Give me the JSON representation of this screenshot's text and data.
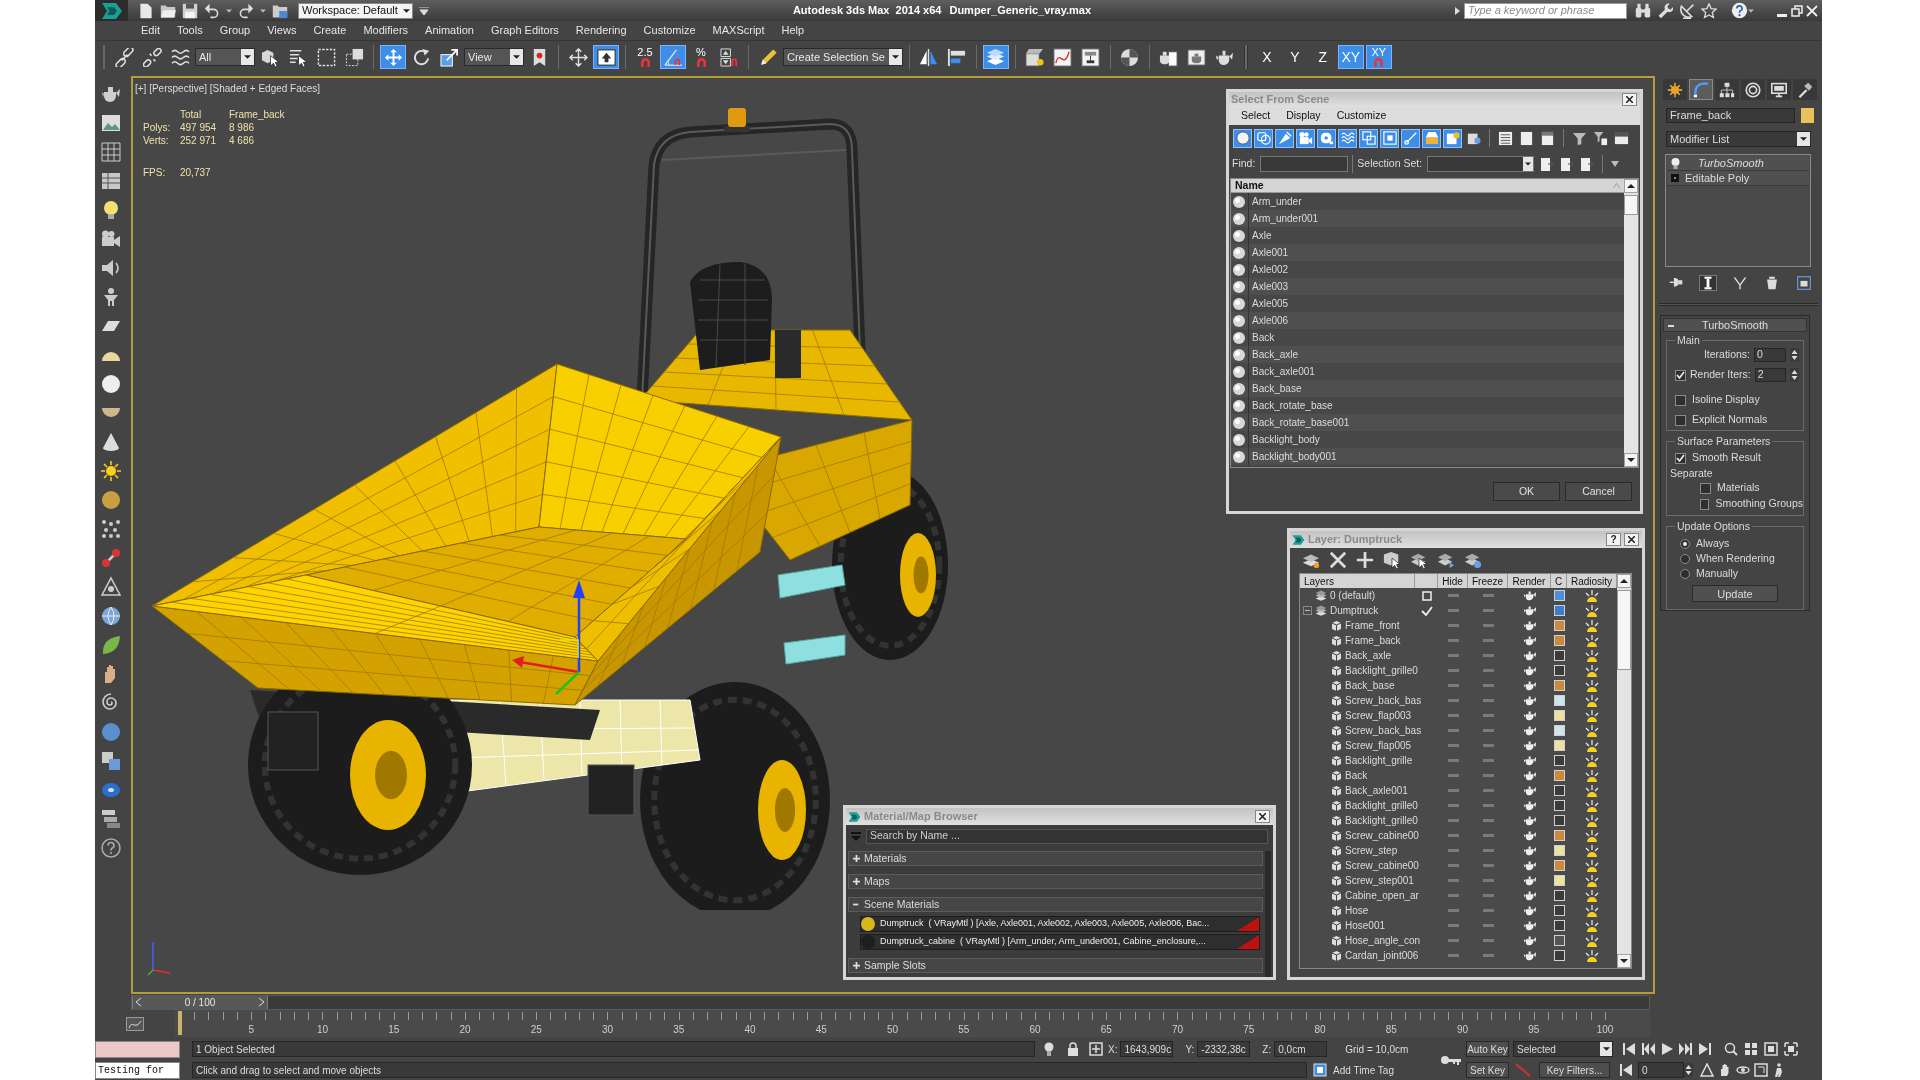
{
  "window": {
    "title": "Autodesk 3ds Max  2014 x64",
    "file": "Dumper_Generic_vray.max",
    "workspace": "Workspace: Default",
    "search": {
      "placeholder": "Type a keyword or phrase"
    }
  },
  "menu": [
    "Edit",
    "Tools",
    "Group",
    "Views",
    "Create",
    "Modifiers",
    "Animation",
    "Graph Editors",
    "Rendering",
    "Customize",
    "MAXScript",
    "Help"
  ],
  "main_toolbar": [
    [
      {
        "kind": "link",
        "selected": false
      },
      {
        "kind": "unlink",
        "selected": false
      },
      {
        "kind": "bind_warp",
        "selected": false
      },
      {
        "kind": "dropdown",
        "value": "All"
      },
      {
        "kind": "select",
        "selected": false
      },
      {
        "kind": "select_by_name",
        "selected": false
      },
      {
        "kind": "rect_region",
        "selected": false
      },
      {
        "kind": "window_crossing",
        "selected": false
      }
    ],
    [
      {
        "kind": "move",
        "selected": true
      },
      {
        "kind": "rotate",
        "selected": false
      },
      {
        "kind": "scale",
        "selected": false
      },
      {
        "kind": "dropdown",
        "value": "View"
      },
      {
        "kind": "pivot",
        "selected": false
      }
    ],
    [
      {
        "kind": "manipulate",
        "selected": false
      },
      {
        "kind": "keyboard_override",
        "selected": true
      }
    ],
    [
      {
        "kind": "snap",
        "label": "2.5",
        "selected": false
      },
      {
        "kind": "angle_snap",
        "selected": true
      },
      {
        "kind": "snap",
        "label": "%",
        "selected": false
      },
      {
        "kind": "spinner_snap",
        "selected": false
      }
    ],
    [
      {
        "kind": "edit_named_sel",
        "selected": false
      },
      {
        "kind": "dropdown",
        "value": "Create Selection Se"
      }
    ],
    [
      {
        "kind": "mirror",
        "selected": false
      },
      {
        "kind": "align",
        "selected": false
      }
    ],
    [
      {
        "kind": "layer_manager",
        "selected": true
      }
    ],
    [
      {
        "kind": "scene_explorer",
        "selected": false
      },
      {
        "kind": "curve_editor",
        "selected": false
      },
      {
        "kind": "schematic",
        "selected": false
      }
    ],
    [
      {
        "kind": "material_editor",
        "selected": false
      }
    ],
    [
      {
        "kind": "render_setup",
        "selected": false
      },
      {
        "kind": "rendered_frame",
        "selected": false
      },
      {
        "kind": "render",
        "selected": false
      }
    ],
    [
      {
        "kind": "axis",
        "label": "X",
        "selected": false
      },
      {
        "kind": "axis",
        "label": "Y",
        "selected": false
      },
      {
        "kind": "axis",
        "label": "Z",
        "selected": false
      },
      {
        "kind": "axis",
        "label": "XY",
        "selected": true
      },
      {
        "kind": "axis_snap",
        "label": "XY",
        "selected": true
      }
    ]
  ],
  "viewport": {
    "label": "[+] [Perspective] [Shaded + Edged Faces]",
    "active": true,
    "stats": {
      "header": [
        "Total",
        "Frame_back"
      ],
      "rows": [
        {
          "label": "Polys:",
          "values": [
            "497 954",
            "8 986"
          ]
        },
        {
          "label": "Verts:",
          "values": [
            "252 971",
            "4 686"
          ]
        }
      ],
      "fps_label": "FPS:",
      "fps": "20,737"
    }
  },
  "select_from_scene": {
    "title": "Select From Scene",
    "menu": [
      "Select",
      "Display",
      "Customize"
    ],
    "filters": [
      {
        "kind": "geometry",
        "on": true
      },
      {
        "kind": "shapes",
        "on": true
      },
      {
        "kind": "lights",
        "on": true
      },
      {
        "kind": "cameras",
        "on": true
      },
      {
        "kind": "helpers",
        "on": true
      },
      {
        "kind": "space_warps",
        "on": true
      },
      {
        "kind": "groups",
        "on": true
      },
      {
        "kind": "xrefs",
        "on": true
      },
      {
        "kind": "bones",
        "on": true
      },
      {
        "kind": "containers",
        "on": true
      },
      {
        "kind": "frozen",
        "on": true
      },
      {
        "kind": "hidden",
        "on": false
      }
    ],
    "find_label": "Find:",
    "selection_set_label": "Selection Set:",
    "column": "Name",
    "rows": [
      {
        "name": "Arm_under",
        "selected": false
      },
      {
        "name": "Arm_under001",
        "selected": false
      },
      {
        "name": "Axle",
        "selected": false
      },
      {
        "name": "Axle001",
        "selected": false
      },
      {
        "name": "Axle002",
        "selected": false
      },
      {
        "name": "Axle003",
        "selected": false
      },
      {
        "name": "Axle005",
        "selected": false
      },
      {
        "name": "Axle006",
        "selected": false
      },
      {
        "name": "Back",
        "selected": false
      },
      {
        "name": "Back_axle",
        "selected": false
      },
      {
        "name": "Back_axle001",
        "selected": false
      },
      {
        "name": "Back_base",
        "selected": false
      },
      {
        "name": "Back_rotate_base",
        "selected": false
      },
      {
        "name": "Back_rotate_base001",
        "selected": false
      },
      {
        "name": "Backlight_body",
        "selected": false
      },
      {
        "name": "Backlight_body001",
        "selected": false
      }
    ],
    "buttons": [
      "OK",
      "Cancel"
    ]
  },
  "layer_manager": {
    "title": "Layer: Dumptruck",
    "help": "?",
    "columns": [
      "Layers",
      "Hide",
      "Freeze",
      "Render",
      "C",
      "Radiosity"
    ],
    "layers": [
      {
        "name": "0 (default)",
        "current": false,
        "hidden": false,
        "frozen": false,
        "renderable": true,
        "color": "#4a8fd8",
        "selected": false
      },
      {
        "name": "Dumptruck",
        "current": true,
        "expanded": true,
        "hidden": false,
        "frozen": false,
        "renderable": true,
        "color": "#3b7fc6",
        "selected": false,
        "children": [
          {
            "name": "Frame_front",
            "hidden": false,
            "frozen": false,
            "renderable": true,
            "color": "#c98a3e",
            "selected": false
          },
          {
            "name": "Frame_back",
            "hidden": false,
            "frozen": false,
            "renderable": true,
            "color": "#c98a3e",
            "selected": false
          },
          {
            "name": "Back_axle",
            "hidden": false,
            "frozen": false,
            "renderable": true,
            "color": "#3a3a3a",
            "selected": false
          },
          {
            "name": "Backlight_grille0",
            "hidden": false,
            "frozen": false,
            "renderable": true,
            "color": "#3a3a3a",
            "selected": false
          },
          {
            "name": "Back_base",
            "hidden": false,
            "frozen": false,
            "renderable": true,
            "color": "#c98a3e",
            "selected": false
          },
          {
            "name": "Screw_back_bas",
            "hidden": false,
            "frozen": false,
            "renderable": true,
            "color": "#cde6ee",
            "selected": false
          },
          {
            "name": "Screw_flap003",
            "hidden": false,
            "frozen": false,
            "renderable": true,
            "color": "#ece3a0",
            "selected": false
          },
          {
            "name": "Screw_back_bas",
            "hidden": false,
            "frozen": false,
            "renderable": true,
            "color": "#cde6ee",
            "selected": false
          },
          {
            "name": "Screw_flap005",
            "hidden": false,
            "frozen": false,
            "renderable": true,
            "color": "#ece3a0",
            "selected": false
          },
          {
            "name": "Backlight_grille",
            "hidden": false,
            "frozen": false,
            "renderable": true,
            "color": "#3a3a3a",
            "selected": false
          },
          {
            "name": "Back",
            "hidden": false,
            "frozen": false,
            "renderable": true,
            "color": "#c98a3e",
            "selected": false
          },
          {
            "name": "Back_axle001",
            "hidden": false,
            "frozen": false,
            "renderable": true,
            "color": "#3a3a3a",
            "selected": false
          },
          {
            "name": "Backlight_grille0",
            "hidden": false,
            "frozen": false,
            "renderable": true,
            "color": "#3a3a3a",
            "selected": false
          },
          {
            "name": "Backlight_grille0",
            "hidden": false,
            "frozen": false,
            "renderable": true,
            "color": "#3a3a3a",
            "selected": false
          },
          {
            "name": "Screw_cabine00",
            "hidden": false,
            "frozen": false,
            "renderable": true,
            "color": "#c98a3e",
            "selected": false
          },
          {
            "name": "Screw_step",
            "hidden": false,
            "frozen": false,
            "renderable": true,
            "color": "#ece3a0",
            "selected": false
          },
          {
            "name": "Screw_cabine00",
            "hidden": false,
            "frozen": false,
            "renderable": true,
            "color": "#c98a3e",
            "selected": false
          },
          {
            "name": "Screw_step001",
            "hidden": false,
            "frozen": false,
            "renderable": true,
            "color": "#ece3a0",
            "selected": false
          },
          {
            "name": "Cabine_open_ar",
            "hidden": false,
            "frozen": false,
            "renderable": true,
            "color": "#3a3a3a",
            "selected": false
          },
          {
            "name": "Hose",
            "hidden": false,
            "frozen": false,
            "renderable": true,
            "color": "#3a3a3a",
            "selected": false
          },
          {
            "name": "Hose001",
            "hidden": false,
            "frozen": false,
            "renderable": true,
            "color": "#3a3a3a",
            "selected": false
          },
          {
            "name": "Hose_angle_con",
            "hidden": false,
            "frozen": false,
            "renderable": true,
            "color": "#555555",
            "selected": false
          },
          {
            "name": "Cardan_joint006",
            "hidden": false,
            "frozen": false,
            "renderable": true,
            "color": "#3a3a3a",
            "selected": false
          }
        ]
      }
    ]
  },
  "material_browser": {
    "title": "Material/Map Browser",
    "search": {
      "placeholder": "Search by Name ..."
    },
    "groups": [
      {
        "label": "Materials",
        "expanded": false
      },
      {
        "label": "Maps",
        "expanded": false
      },
      {
        "label": "Scene Materials",
        "expanded": true,
        "items": [
          {
            "text": "Dumptruck  ( VRayMtl ) [Axle, Axle001, Axle002, Axle003, Axle005, Axle006, Bac...",
            "color": "#d8b818",
            "selected": false
          },
          {
            "text": "Dumptruck_cabine  ( VRayMtl ) [Arm_under, Arm_under001, Cabine_enclosure,...",
            "color": "#1e1e1e",
            "selected": false
          }
        ]
      },
      {
        "label": "Sample Slots",
        "expanded": false
      }
    ]
  },
  "command_panel": {
    "tabs": [
      {
        "kind": "create",
        "selected": false
      },
      {
        "kind": "modify",
        "selected": true
      },
      {
        "kind": "hierarchy",
        "selected": false
      },
      {
        "kind": "motion",
        "selected": false
      },
      {
        "kind": "display",
        "selected": false
      },
      {
        "kind": "utilities",
        "selected": false
      }
    ],
    "object": {
      "name": "Frame_back",
      "color": "#e8c35a"
    },
    "modifier_list": "Modifier List",
    "stack": [
      {
        "name": "TurboSmooth",
        "kind": "modifier",
        "viewport_off": true,
        "selected": false
      },
      {
        "name": "Editable Poly",
        "kind": "base_object",
        "viewport_off": false,
        "selected": false
      }
    ],
    "stack_tools": [
      {
        "kind": "pin",
        "on": false
      },
      {
        "kind": "show_end_result",
        "on": true
      },
      {
        "kind": "make_unique",
        "on": false
      },
      {
        "kind": "remove",
        "on": false
      },
      {
        "kind": "configure",
        "on": false
      }
    ],
    "rollout": {
      "title": "TurboSmooth",
      "expanded": true,
      "main": {
        "label": "Main",
        "iterations": {
          "label": "Iterations:",
          "value": "0"
        },
        "render_iters": {
          "label": "Render Iters:",
          "value": "2",
          "checked": true
        },
        "options": [
          {
            "label": "Isoline Display",
            "checked": false
          },
          {
            "label": "Explicit Normals",
            "checked": false
          }
        ]
      },
      "surface": {
        "label": "Surface Parameters",
        "smooth_result": {
          "label": "Smooth Result",
          "checked": true
        },
        "separate_label": "Separate",
        "separate": [
          {
            "label": "Materials",
            "checked": false
          },
          {
            "label": "Smoothing Groups",
            "checked": false
          }
        ]
      },
      "update": {
        "label": "Update Options",
        "options": [
          {
            "label": "Always",
            "selected": true
          },
          {
            "label": "When Rendering",
            "selected": false
          },
          {
            "label": "Manually",
            "selected": false
          }
        ],
        "button": "Update"
      }
    }
  },
  "time_slider": {
    "label": "0 / 100",
    "level": 0
  },
  "track_bar": {
    "ticks": [
      "5",
      "10",
      "15",
      "20",
      "25",
      "30",
      "35",
      "40",
      "45",
      "50",
      "55",
      "60",
      "65",
      "70",
      "75",
      "80",
      "85",
      "90",
      "95",
      "100"
    ]
  },
  "status": {
    "listener": "Testing for",
    "selection": "1 Object Selected",
    "prompt": "Click and drag to select and move objects",
    "coords": [
      {
        "label": "X:",
        "value": "1643,909c"
      },
      {
        "label": "Y:",
        "value": "-2332,38c"
      },
      {
        "label": "Z:",
        "value": "0,0cm"
      }
    ],
    "grid": "Grid = 10,0cm",
    "time_tag": "Add Time Tag",
    "auto_key": {
      "label": "Auto Key",
      "on": false
    },
    "set_key": "Set Key",
    "key_mode": "Selected",
    "key_filters": "Key Filters...",
    "frame": "0"
  }
}
